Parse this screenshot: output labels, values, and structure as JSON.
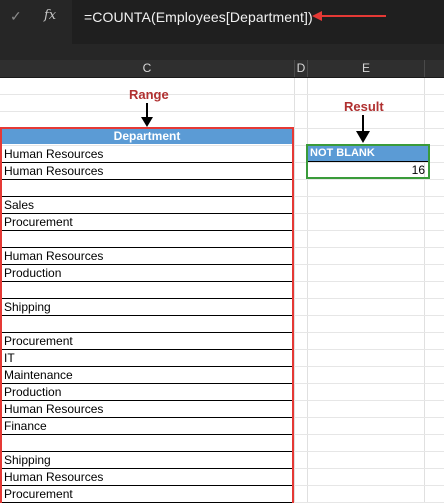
{
  "formula_bar": {
    "cancel_icon": "check-icon",
    "fx_label": "fx",
    "formula": "=COUNTA(Employees[Department])"
  },
  "columns": [
    "C",
    "D",
    "E"
  ],
  "annotations": {
    "range_label": "Range",
    "result_label": "Result"
  },
  "table": {
    "header": "Department",
    "rows": [
      "Human Resources",
      "Human Resources",
      "",
      "Sales",
      "Procurement",
      "",
      "Human Resources",
      "Production",
      "",
      "Shipping",
      "",
      "Procurement",
      "IT",
      "Maintenance",
      "Production",
      "Human Resources",
      "Finance",
      "",
      "Shipping",
      "Human Resources",
      "Procurement"
    ]
  },
  "result": {
    "header": "NOT BLANK",
    "value": "16"
  },
  "colors": {
    "table_header": "#5b9bd5",
    "range_border": "#e53935",
    "result_border": "#3a9b3a",
    "annotation_text": "#b03030"
  }
}
